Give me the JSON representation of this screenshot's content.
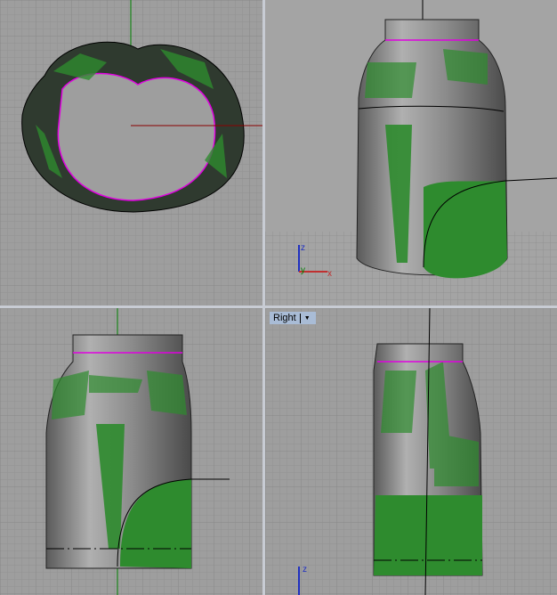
{
  "viewports": [
    {
      "id": "top",
      "label": ""
    },
    {
      "id": "perspective",
      "label": ""
    },
    {
      "id": "front",
      "label": ""
    },
    {
      "id": "right",
      "label": "Right"
    }
  ],
  "axis_labels": {
    "x": "x",
    "y": "y",
    "z": "z"
  },
  "colors": {
    "background": "#9e9e9e",
    "grid": "#8e8e8e",
    "surface": "#8a8a8a",
    "green": "#2e8b2e",
    "magenta": "#e000e0",
    "axis_x": "#8b0000",
    "axis_y": "#008000",
    "border": "#c8ccd4"
  },
  "icons": {
    "viewport_menu": "triangle-down-icon"
  }
}
